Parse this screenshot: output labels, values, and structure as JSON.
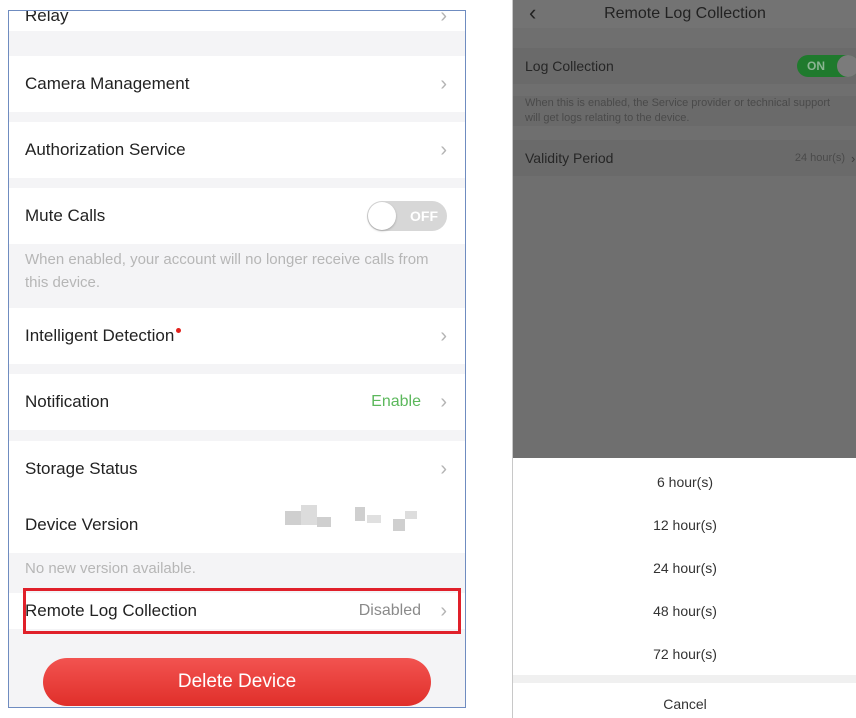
{
  "left": {
    "relay": {
      "label": "Relay"
    },
    "camera": {
      "label": "Camera Management"
    },
    "authorization": {
      "label": "Authorization Service"
    },
    "mute": {
      "label": "Mute Calls",
      "toggle": "OFF",
      "note": "When enabled, your account will no longer receive calls from this device."
    },
    "intelligent": {
      "label": "Intelligent Detection"
    },
    "notification": {
      "label": "Notification",
      "value": "Enable",
      "value_color": "#5cb85c"
    },
    "storage": {
      "label": "Storage Status"
    },
    "version": {
      "label": "Device Version",
      "note": "No new version available."
    },
    "remote_log": {
      "label": "Remote Log Collection",
      "value": "Disabled"
    },
    "delete_label": "Delete Device"
  },
  "right": {
    "nav": {
      "title": "Remote Log Collection"
    },
    "log": {
      "label": "Log Collection",
      "toggle": "ON",
      "note": "When this is enabled, the Service provider or technical support will get logs relating to the device."
    },
    "validity": {
      "label": "Validity Period",
      "value": "24 hour(s)"
    },
    "options": [
      "6 hour(s)",
      "12 hour(s)",
      "24 hour(s)",
      "48 hour(s)",
      "72 hour(s)"
    ],
    "cancel": "Cancel"
  },
  "colors": {
    "accent_red": "#e02f2a",
    "toggle_on": "#1f7a2d"
  }
}
